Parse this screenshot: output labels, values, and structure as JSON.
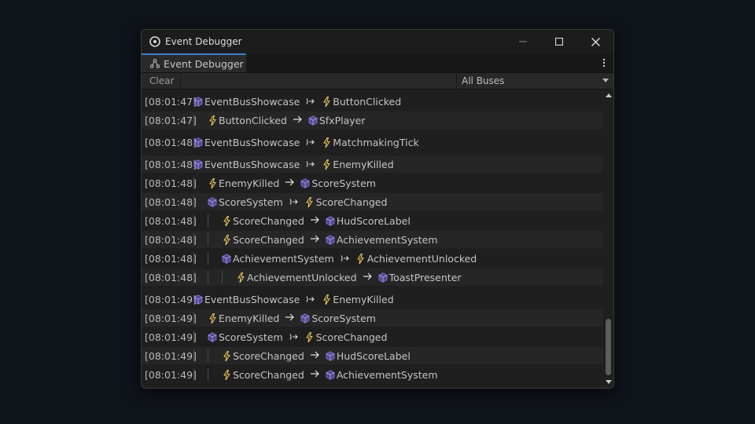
{
  "window": {
    "title": "Event Debugger",
    "tab_label": "Event Debugger"
  },
  "toolbar": {
    "clear_label": "Clear",
    "bus_filter": "All Buses"
  },
  "colors": {
    "event": "#e8c75a",
    "node": "#7b6ad9",
    "tab_accent": "#3b7fd1"
  },
  "log": [
    {
      "ts": "[08:01:47]",
      "depth": 0,
      "kind": "emit",
      "from": "EventBusShowcase",
      "to": "ButtonClicked"
    },
    {
      "ts": "[08:01:47]",
      "depth": 1,
      "kind": "deliver",
      "from": "ButtonClicked",
      "to": "SfxPlayer"
    },
    {
      "ts": "[08:01:48]",
      "depth": 0,
      "kind": "emit",
      "from": "EventBusShowcase",
      "to": "MatchmakingTick"
    },
    {
      "ts": "[08:01:48]",
      "depth": 0,
      "kind": "emit",
      "from": "EventBusShowcase",
      "to": "EnemyKilled"
    },
    {
      "ts": "[08:01:48]",
      "depth": 1,
      "kind": "deliver",
      "from": "EnemyKilled",
      "to": "ScoreSystem"
    },
    {
      "ts": "[08:01:48]",
      "depth": 1,
      "kind": "emit",
      "from": "ScoreSystem",
      "to": "ScoreChanged"
    },
    {
      "ts": "[08:01:48]",
      "depth": 2,
      "kind": "deliver",
      "from": "ScoreChanged",
      "to": "HudScoreLabel"
    },
    {
      "ts": "[08:01:48]",
      "depth": 2,
      "kind": "deliver",
      "from": "ScoreChanged",
      "to": "AchievementSystem"
    },
    {
      "ts": "[08:01:48]",
      "depth": 2,
      "kind": "emit",
      "from": "AchievementSystem",
      "to": "AchievementUnlocked"
    },
    {
      "ts": "[08:01:48]",
      "depth": 3,
      "kind": "deliver",
      "from": "AchievementUnlocked",
      "to": "ToastPresenter"
    },
    {
      "ts": "[08:01:49]",
      "depth": 0,
      "kind": "emit",
      "from": "EventBusShowcase",
      "to": "EnemyKilled"
    },
    {
      "ts": "[08:01:49]",
      "depth": 1,
      "kind": "deliver",
      "from": "EnemyKilled",
      "to": "ScoreSystem"
    },
    {
      "ts": "[08:01:49]",
      "depth": 1,
      "kind": "emit",
      "from": "ScoreSystem",
      "to": "ScoreChanged"
    },
    {
      "ts": "[08:01:49]",
      "depth": 2,
      "kind": "deliver",
      "from": "ScoreChanged",
      "to": "HudScoreLabel"
    },
    {
      "ts": "[08:01:49]",
      "depth": 2,
      "kind": "deliver",
      "from": "ScoreChanged",
      "to": "AchievementSystem"
    }
  ]
}
